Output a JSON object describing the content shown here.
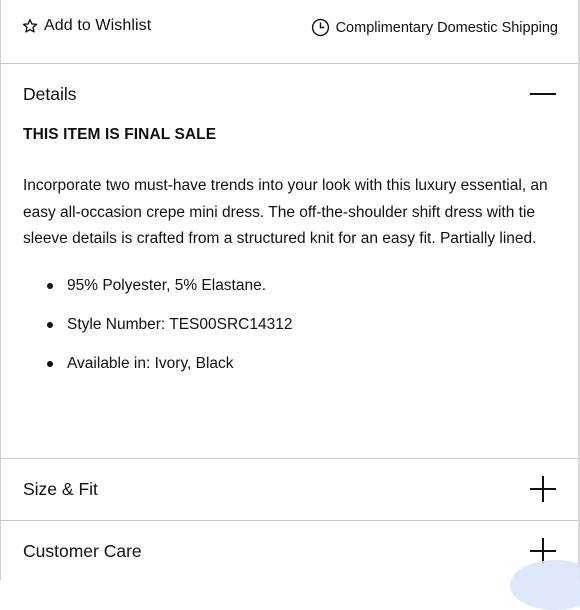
{
  "topbar": {
    "wishlist_label": "Add to Wishlist",
    "shipping_label": "Complimentary Domestic Shipping"
  },
  "details": {
    "title": "Details",
    "final_sale": "THIS ITEM IS FINAL SALE",
    "description": "Incorporate two must-have trends into your look with this luxury essential, an easy all-occasion crepe mini dress. The off-the-shoulder shift dress with tie sleeve details is crafted from a structured knit for an easy fit. Partially lined.",
    "bullets": [
      "95% Polyester, 5% Elastane.",
      "Style Number: TES00SRC14312",
      "Available in: Ivory, Black"
    ],
    "state_icon": "minus-icon"
  },
  "size_fit": {
    "title": "Size & Fit",
    "state_icon": "plus-icon"
  },
  "customer_care": {
    "title": "Customer Care",
    "state_icon": "plus-icon"
  },
  "colors": {
    "text": "#111111",
    "divider": "#c9c9c9",
    "accent_hint": "#d9e7fb"
  }
}
